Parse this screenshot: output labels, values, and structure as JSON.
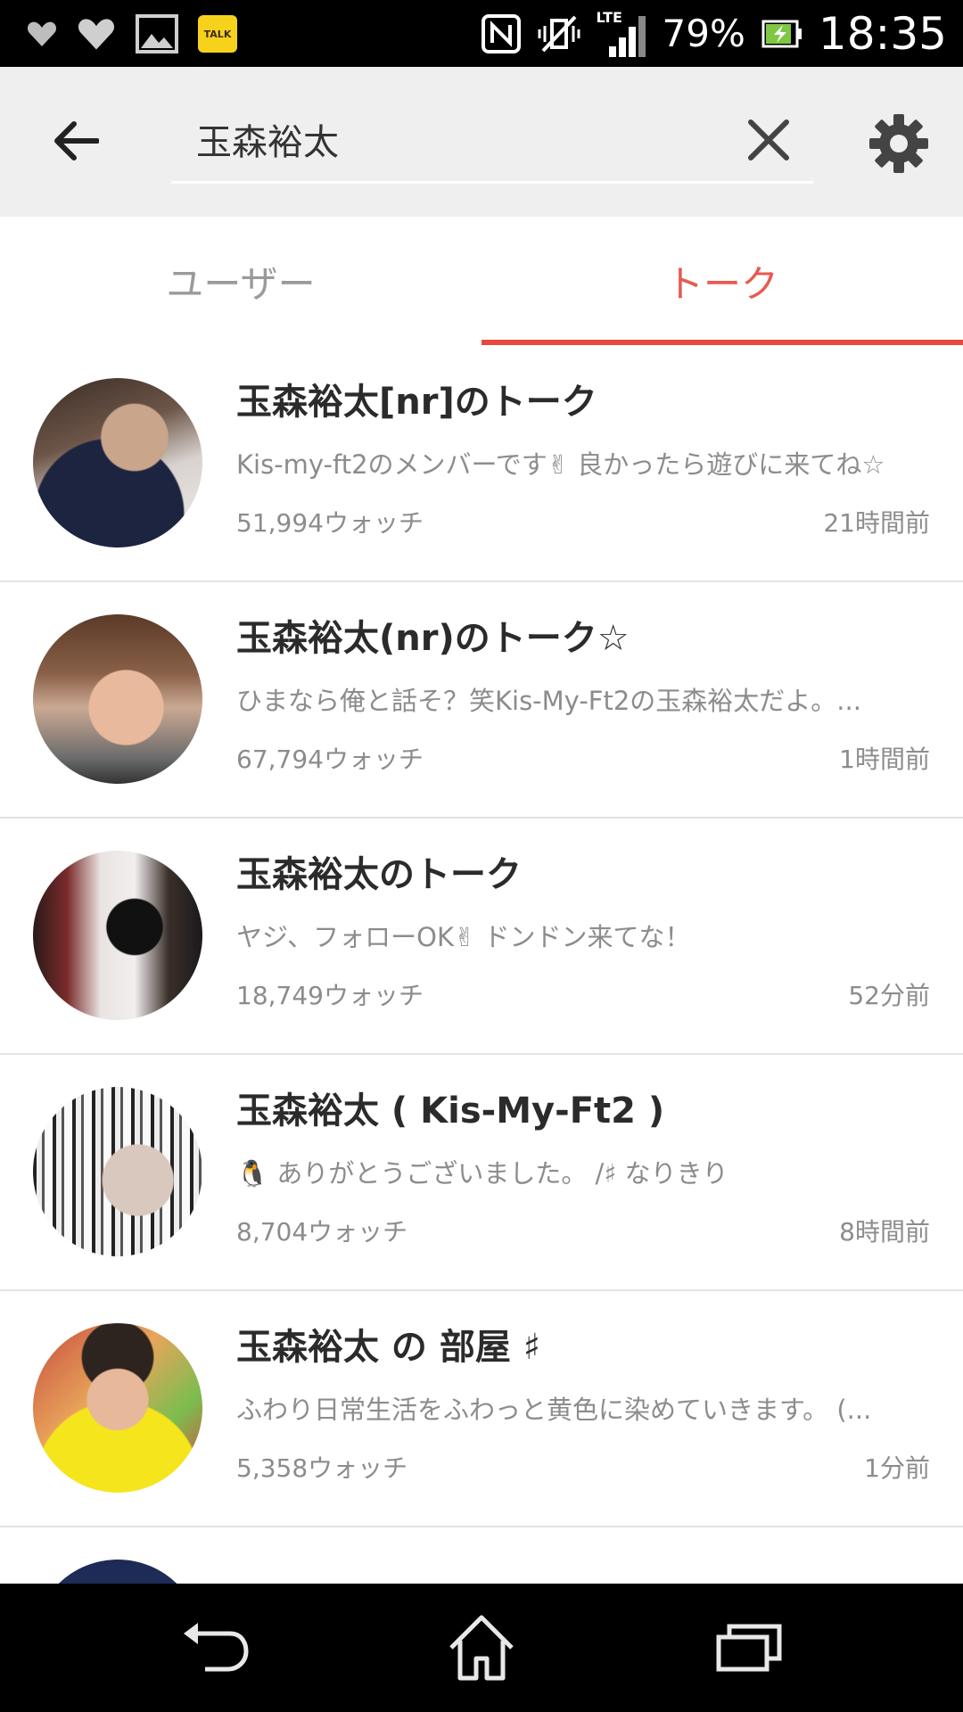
{
  "status_bar": {
    "talk_badge": "TALK",
    "network": "LTE",
    "battery_percent": "79%",
    "time": "18:35",
    "icons": [
      "heart-icon",
      "heart-icon",
      "image-icon",
      "talk-icon",
      "nfc-icon",
      "vibrate-icon",
      "signal-icon",
      "battery-icon"
    ]
  },
  "header": {
    "search_value": "玉森裕太",
    "icons": [
      "back-arrow-icon",
      "close-icon",
      "gear-icon"
    ]
  },
  "tabs": [
    {
      "label": "ユーザー",
      "active": false
    },
    {
      "label": "トーク",
      "active": true
    }
  ],
  "accent_color": "#e8483e",
  "talks": [
    {
      "title": "玉森裕太[nr]のトーク",
      "description": "Kis-my-ft2のメンバーです✌ 良かったら遊びに来てね☆",
      "watchers": "51,994ウォッチ",
      "time": "21時間前"
    },
    {
      "title": "玉森裕太(nr)のトーク☆",
      "description": "ひまなら俺と話そ？笑Kis-My-Ft2の玉森裕太だよ。...",
      "watchers": "67,794ウォッチ",
      "time": "1時間前"
    },
    {
      "title": "玉森裕太のトーク",
      "description": "ヤジ、フォローOK✌ ドンドン来てな！",
      "watchers": "18,749ウォッチ",
      "time": "52分前"
    },
    {
      "title": "玉森裕太 ( Kis-My-Ft2 )",
      "description": "🐧 ありがとうございました。 /♯ なりきり",
      "watchers": "8,704ウォッチ",
      "time": "8時間前"
    },
    {
      "title": "玉森裕太 の 部屋 ♯",
      "description": "ふわり日常生活をふわっと黄色に染めていきます。 (...",
      "watchers": "5,358ウォッチ",
      "time": "1分前"
    }
  ],
  "nav_bar": {
    "icons": [
      "back-icon",
      "home-icon",
      "recent-apps-icon"
    ]
  }
}
